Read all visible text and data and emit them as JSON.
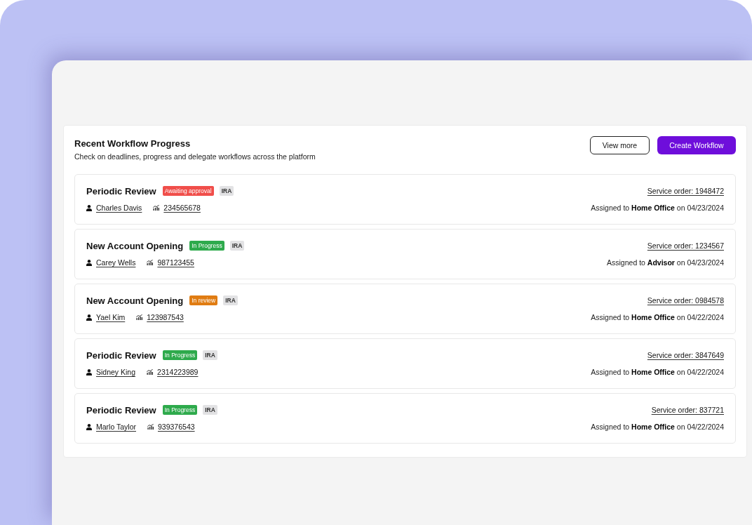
{
  "header": {
    "title": "Recent Workflow Progress",
    "subtitle": "Check on deadlines, progress and delegate workflows across the platform"
  },
  "buttons": [
    {
      "label": "View more",
      "kind": "secondary"
    },
    {
      "label": "Create Workflow",
      "kind": "primary"
    }
  ],
  "workflows": [
    {
      "title": "Periodic Review",
      "status": {
        "label": "Awaiting approval",
        "color": "#f04e4a"
      },
      "tag": "IRA",
      "client": "Charles Davis",
      "account": "234565678",
      "service_order": "Service order: 1948472",
      "assignment": "Assigned to **Home Office** on 04/23/2024"
    },
    {
      "title": "New Account Opening",
      "status": {
        "label": "In Progress",
        "color": "#2eaa4c"
      },
      "tag": "IRA",
      "client": "Carey Wells",
      "account": "987123455",
      "service_order": "Service order: 1234567",
      "assignment": "Assigned to **Advisor** on 04/23/2024"
    },
    {
      "title": "New Account Opening",
      "status": {
        "label": "In review",
        "color": "#e07c12"
      },
      "tag": "IRA",
      "client": "Yael Kim",
      "account": "123987543",
      "service_order": "Service order: 0984578",
      "assignment": "Assigned to **Home Office** on 04/22/2024"
    },
    {
      "title": "Periodic Review",
      "status": {
        "label": "In Progress",
        "color": "#2eaa4c"
      },
      "tag": "IRA",
      "client": "Sidney King",
      "account": "2314223989",
      "service_order": "Service order: 3847649",
      "assignment": "Assigned to **Home Office** on 04/22/2024"
    },
    {
      "title": "Periodic Review",
      "status": {
        "label": "In Progress",
        "color": "#2eaa4c"
      },
      "tag": "IRA",
      "client": "Marlo Taylor",
      "account": "939376543",
      "service_order": "Service order: 837721",
      "assignment": "Assigned to **Home Office** on 04/22/2024"
    }
  ]
}
